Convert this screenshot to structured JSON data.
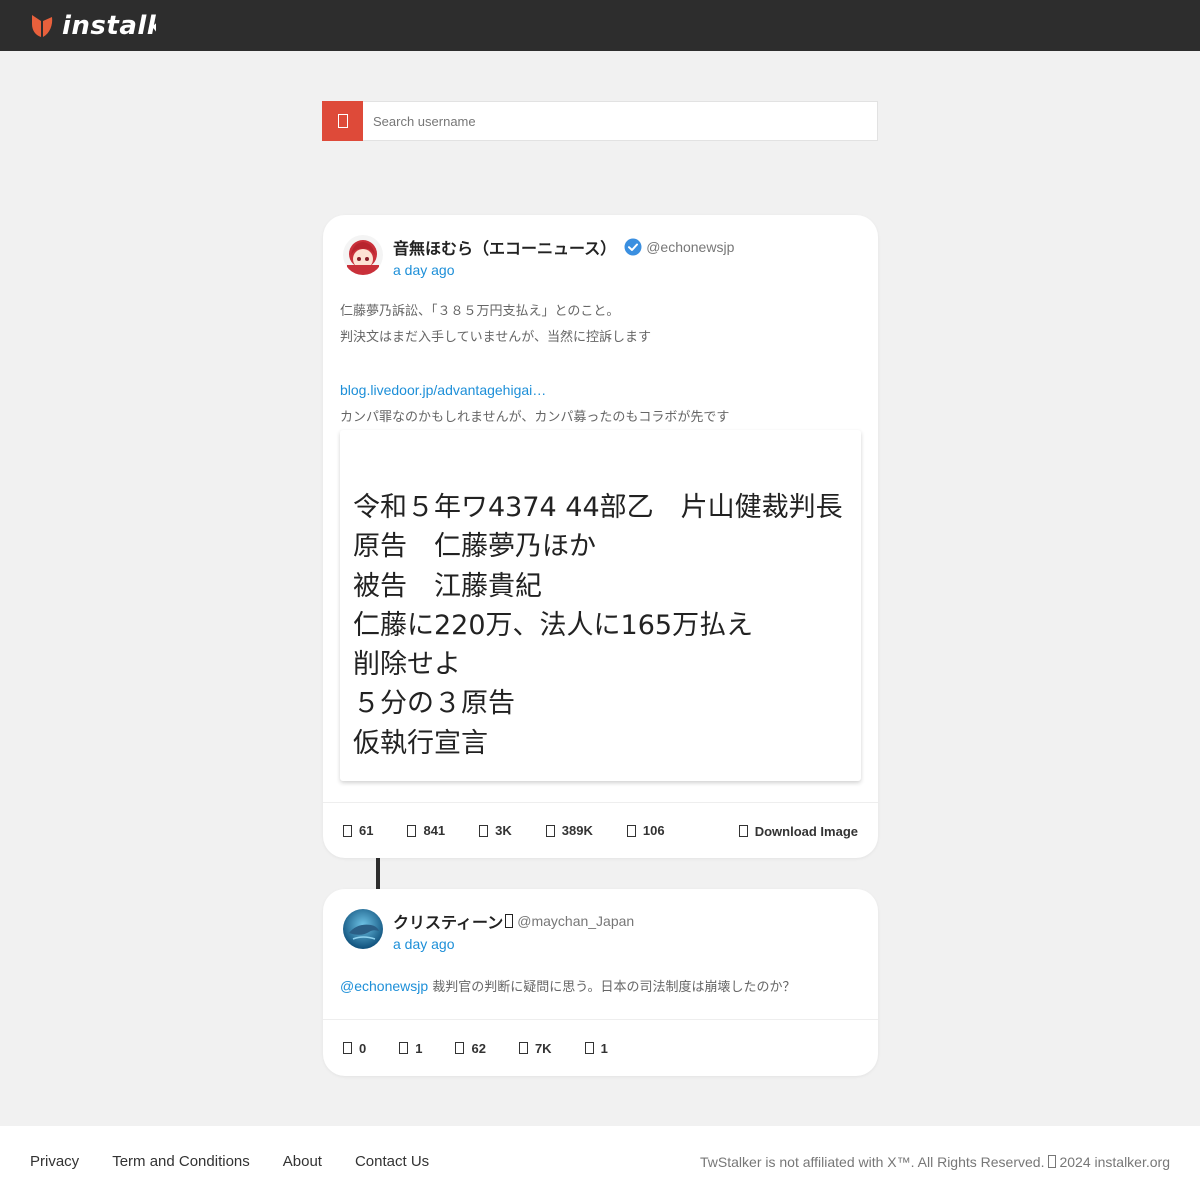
{
  "header": {
    "brand": "instalk",
    "logo": "instalker-logo"
  },
  "search": {
    "placeholder": "Search username",
    "icon": "search-icon",
    "accent": "#de4a39"
  },
  "tweet": {
    "author": {
      "name": "音無ほむら（エコーニュース）",
      "handle": "@echonewsjp",
      "verified": true,
      "time": "a day ago"
    },
    "lines": [
      "仁藤夢乃訴訟、「３８５万円支払え」とのこと。",
      "判決文はまだ入手していませんが、当然に控訴します",
      ""
    ],
    "link": "blog.livedoor.jp/advantagehigai…",
    "after_link": "カンパ罪なのかもしれませんが、カンパ募ったのもコラボが先です",
    "image_lines": [
      "令和５年ワ4374 44部乙　片山健裁判長",
      "原告　仁藤夢乃ほか",
      "被告　江藤貴紀",
      "仁藤に220万、法人に165万払え",
      "削除せよ",
      "５分の３原告",
      "仮執行宣言"
    ],
    "stats": [
      {
        "icon": "comment-icon",
        "value": "61"
      },
      {
        "icon": "retweet-icon",
        "value": "841"
      },
      {
        "icon": "heart-icon",
        "value": "3K"
      },
      {
        "icon": "views-icon",
        "value": "389K"
      },
      {
        "icon": "bookmark-icon",
        "value": "106"
      }
    ],
    "download_label": "Download Image"
  },
  "reply": {
    "author": {
      "name": "クリスティーン",
      "handle": "@maychan_Japan",
      "time": "a day ago"
    },
    "mention": "@echonewsjp",
    "text": " 裁判官の判断に疑問に思う。日本の司法制度は崩壊したのか？",
    "stats": [
      {
        "icon": "comment-icon",
        "value": "0"
      },
      {
        "icon": "retweet-icon",
        "value": "1"
      },
      {
        "icon": "heart-icon",
        "value": "62"
      },
      {
        "icon": "views-icon",
        "value": "7K"
      },
      {
        "icon": "bookmark-icon",
        "value": "1"
      }
    ]
  },
  "footer": {
    "links": [
      "Privacy",
      "Term and Conditions",
      "About",
      "Contact Us"
    ],
    "copyright": "TwStalker is not affiliated with X™. All Rights Reserved.",
    "year_site": "2024 instalker.org"
  },
  "colors": {
    "topbar": "#2d2d2d",
    "link": "#1d8fd8",
    "verified": "#3a8fe0",
    "background": "#f1f1f1"
  }
}
